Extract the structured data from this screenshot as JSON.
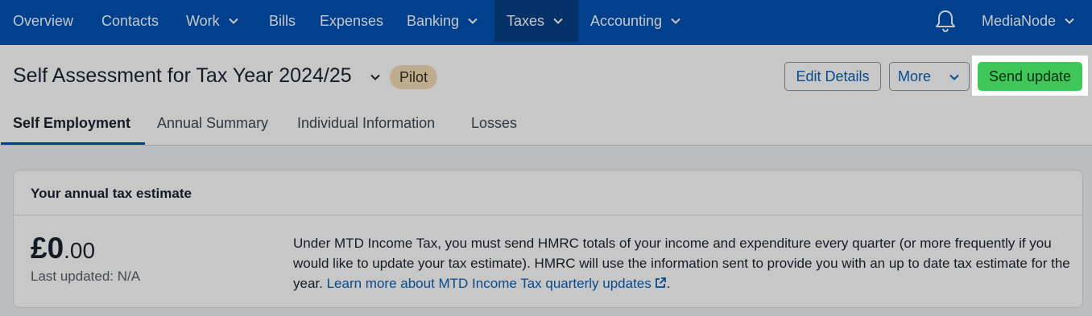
{
  "nav": {
    "items": [
      {
        "label": "Overview"
      },
      {
        "label": "Contacts"
      },
      {
        "label": "Work"
      },
      {
        "label": "Bills"
      },
      {
        "label": "Expenses"
      },
      {
        "label": "Banking"
      },
      {
        "label": "Taxes"
      },
      {
        "label": "Accounting"
      }
    ],
    "account_label": "MediaNode",
    "bell_icon": "bell-icon"
  },
  "header": {
    "title": "Self Assessment for Tax Year 2024/25",
    "badge": "Pilot",
    "edit_label": "Edit Details",
    "more_label": "More",
    "send_label": "Send update"
  },
  "tabs": [
    {
      "label": "Self Employment",
      "active": true
    },
    {
      "label": "Annual Summary"
    },
    {
      "label": "Individual Information"
    },
    {
      "label": "Losses"
    }
  ],
  "card": {
    "title": "Your annual tax estimate",
    "amount_main": "£0",
    "amount_decimal": ".00",
    "last_updated": "Last updated: N/A",
    "description": "Under MTD Income Tax, you must send HMRC totals of your income and expenditure every quarter (or more frequently if you would like to update your tax estimate). HMRC will use the information sent to provide you with an up to date tax estimate for the year. ",
    "link_text": "Learn more about MTD Income Tax quarterly updates",
    "after_link": "."
  },
  "colors": {
    "nav_bg": "#0052b4",
    "send_button": "#3fc75a",
    "link": "#0c5fb5",
    "badge_bg": "#f3ddb6"
  }
}
